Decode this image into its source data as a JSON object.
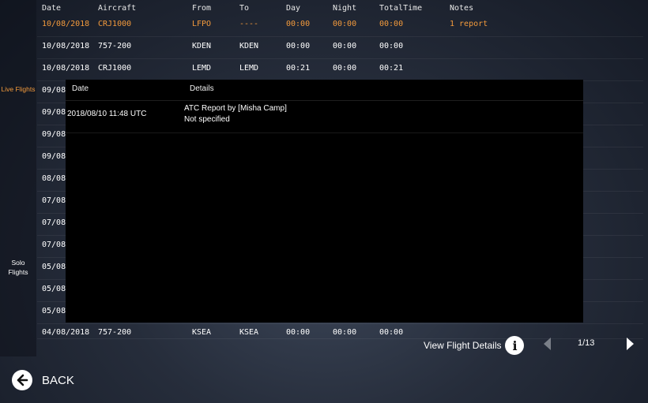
{
  "sidebar": {
    "live_label": "Live Flights",
    "solo_label": "Solo\nFlights"
  },
  "logbook": {
    "headers": [
      "Date",
      "Aircraft",
      "From",
      "To",
      "Day",
      "Night",
      "TotalTime",
      "Notes"
    ],
    "rows": [
      [
        "10/08/2018",
        "CRJ1000",
        "LFPO",
        "----",
        "00:00",
        "00:00",
        "00:00",
        "1 report"
      ],
      [
        "10/08/2018",
        "757-200",
        "KDEN",
        "KDEN",
        "00:00",
        "00:00",
        "00:00",
        ""
      ],
      [
        "10/08/2018",
        "CRJ1000",
        "LEMD",
        "LEMD",
        "00:21",
        "00:00",
        "00:21",
        ""
      ],
      [
        "09/08",
        "",
        "",
        "",
        "",
        "",
        "",
        ""
      ],
      [
        "09/08",
        "",
        "",
        "",
        "",
        "",
        "",
        ""
      ],
      [
        "09/08",
        "",
        "",
        "",
        "",
        "",
        "",
        ""
      ],
      [
        "09/08",
        "",
        "",
        "",
        "",
        "",
        "",
        ""
      ],
      [
        "08/08",
        "",
        "",
        "",
        "",
        "",
        "",
        ""
      ],
      [
        "07/08",
        "",
        "",
        "",
        "",
        "",
        "",
        ""
      ],
      [
        "07/08",
        "",
        "",
        "",
        "",
        "",
        "",
        ""
      ],
      [
        "07/08",
        "",
        "",
        "",
        "",
        "",
        "",
        ""
      ],
      [
        "05/08",
        "",
        "",
        "",
        "",
        "",
        "",
        ""
      ],
      [
        "05/08",
        "",
        "",
        "",
        "",
        "",
        "",
        ""
      ],
      [
        "05/08",
        "",
        "",
        "",
        "",
        "",
        "",
        ""
      ],
      [
        "04/08/2018",
        "757-200",
        "KSEA",
        "KSEA",
        "00:00",
        "00:00",
        "00:00",
        ""
      ]
    ]
  },
  "report_popup": {
    "headers": {
      "date": "Date",
      "details": "Details"
    },
    "entries": [
      {
        "date": "2018/08/10 11:48 UTC",
        "title": "ATC Report by [Misha Camp]",
        "detail": "Not specified"
      }
    ]
  },
  "footer": {
    "view_details": "View Flight Details",
    "info_icon": "i",
    "page": "1/13",
    "back": "BACK"
  },
  "colors": {
    "accent": "#f39a3c",
    "popup_bg": "#000000"
  }
}
